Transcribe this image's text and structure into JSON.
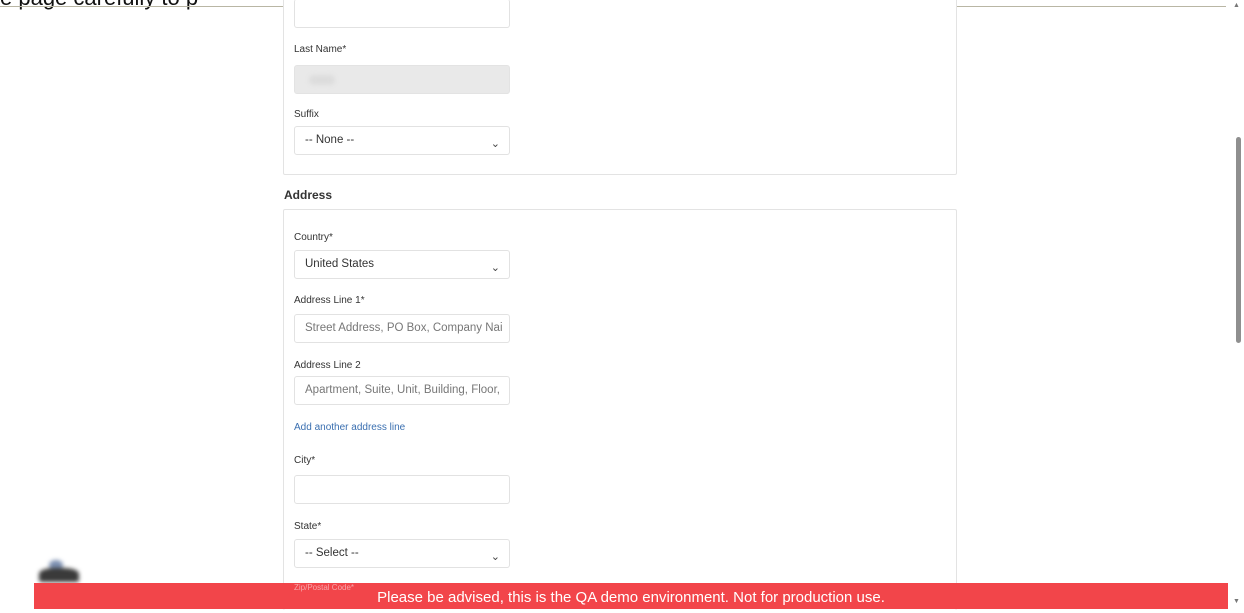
{
  "header": {
    "partial_text": "e page carefully to p"
  },
  "name_section": {
    "last_name": {
      "label": "Last Name*",
      "value": ""
    },
    "suffix": {
      "label": "Suffix",
      "value": "-- None --"
    }
  },
  "address_section": {
    "title": "Address",
    "country": {
      "label": "Country*",
      "value": "United States"
    },
    "address_line_1": {
      "label": "Address Line 1*",
      "placeholder": "Street Address, PO Box, Company Nai"
    },
    "address_line_2": {
      "label": "Address Line 2",
      "placeholder": "Apartment, Suite, Unit, Building, Floor,"
    },
    "add_line_link": "Add another address line",
    "city": {
      "label": "City*",
      "value": ""
    },
    "state": {
      "label": "State*",
      "value": "-- Select --"
    },
    "zip": {
      "label": "Zip/Postal Code*"
    }
  },
  "banner": {
    "text": "Please be advised, this is the QA demo environment. Not for production use."
  },
  "icons": {
    "chevron": "chevron-down-icon",
    "scroll_up": "scroll-up-arrow-icon",
    "scroll_down": "scroll-down-arrow-icon"
  },
  "colors": {
    "banner": "#f2454a",
    "link": "#3a6fb0"
  }
}
